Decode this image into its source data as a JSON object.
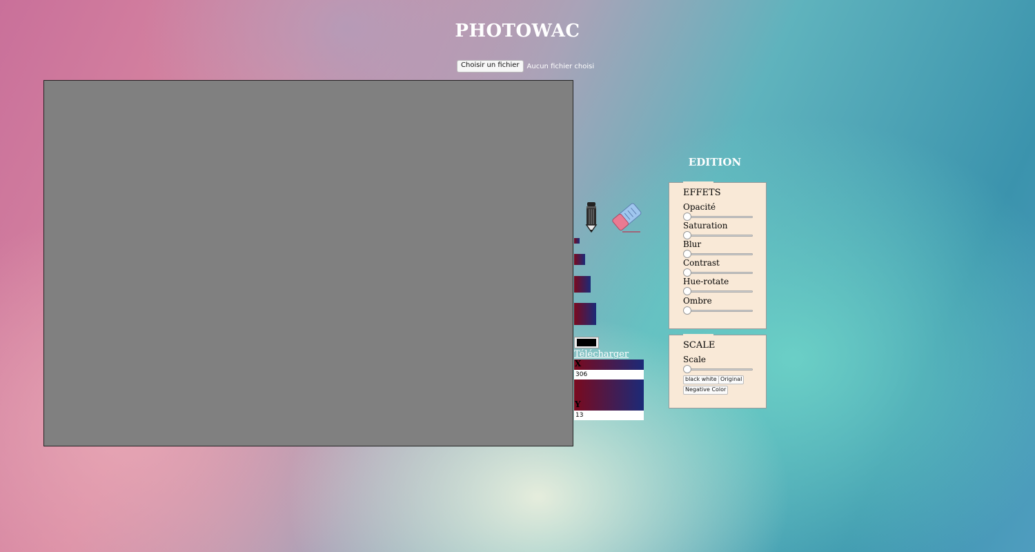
{
  "app": {
    "title": "PHOTOWAC"
  },
  "file": {
    "button_label": "Choisir un fichier",
    "status": "Aucun fichier choisi"
  },
  "canvas": {
    "background": "#808080"
  },
  "tools": {
    "pencil_icon": "pencil-icon",
    "eraser_icon": "eraser-icon"
  },
  "brush_sizes": [
    {
      "icon": "brush-size-small"
    },
    {
      "icon": "brush-size-medium"
    },
    {
      "icon": "brush-size-large"
    },
    {
      "icon": "brush-size-xlarge"
    }
  ],
  "color": {
    "value": "#000000"
  },
  "download": {
    "label": "Télécharger"
  },
  "coords": {
    "x_label": "X",
    "x_value": "306",
    "y_label": "Y",
    "y_value": "13"
  },
  "edition": {
    "title": "EDITION",
    "effets": {
      "heading": "EFFETS",
      "sliders": [
        {
          "label": "Opacité"
        },
        {
          "label": "Saturation"
        },
        {
          "label": "Blur"
        },
        {
          "label": "Contrast"
        },
        {
          "label": "Hue-rotate"
        },
        {
          "label": "Ombre"
        }
      ]
    },
    "scale": {
      "heading": "SCALE",
      "slider_label": "Scale",
      "buttons": [
        "black white",
        "Original",
        "Negative Color"
      ]
    }
  },
  "colors": {
    "swatch_start": "#7a0a1e",
    "swatch_end": "#1b2a78",
    "panel_bg": "#f9e9d7"
  }
}
